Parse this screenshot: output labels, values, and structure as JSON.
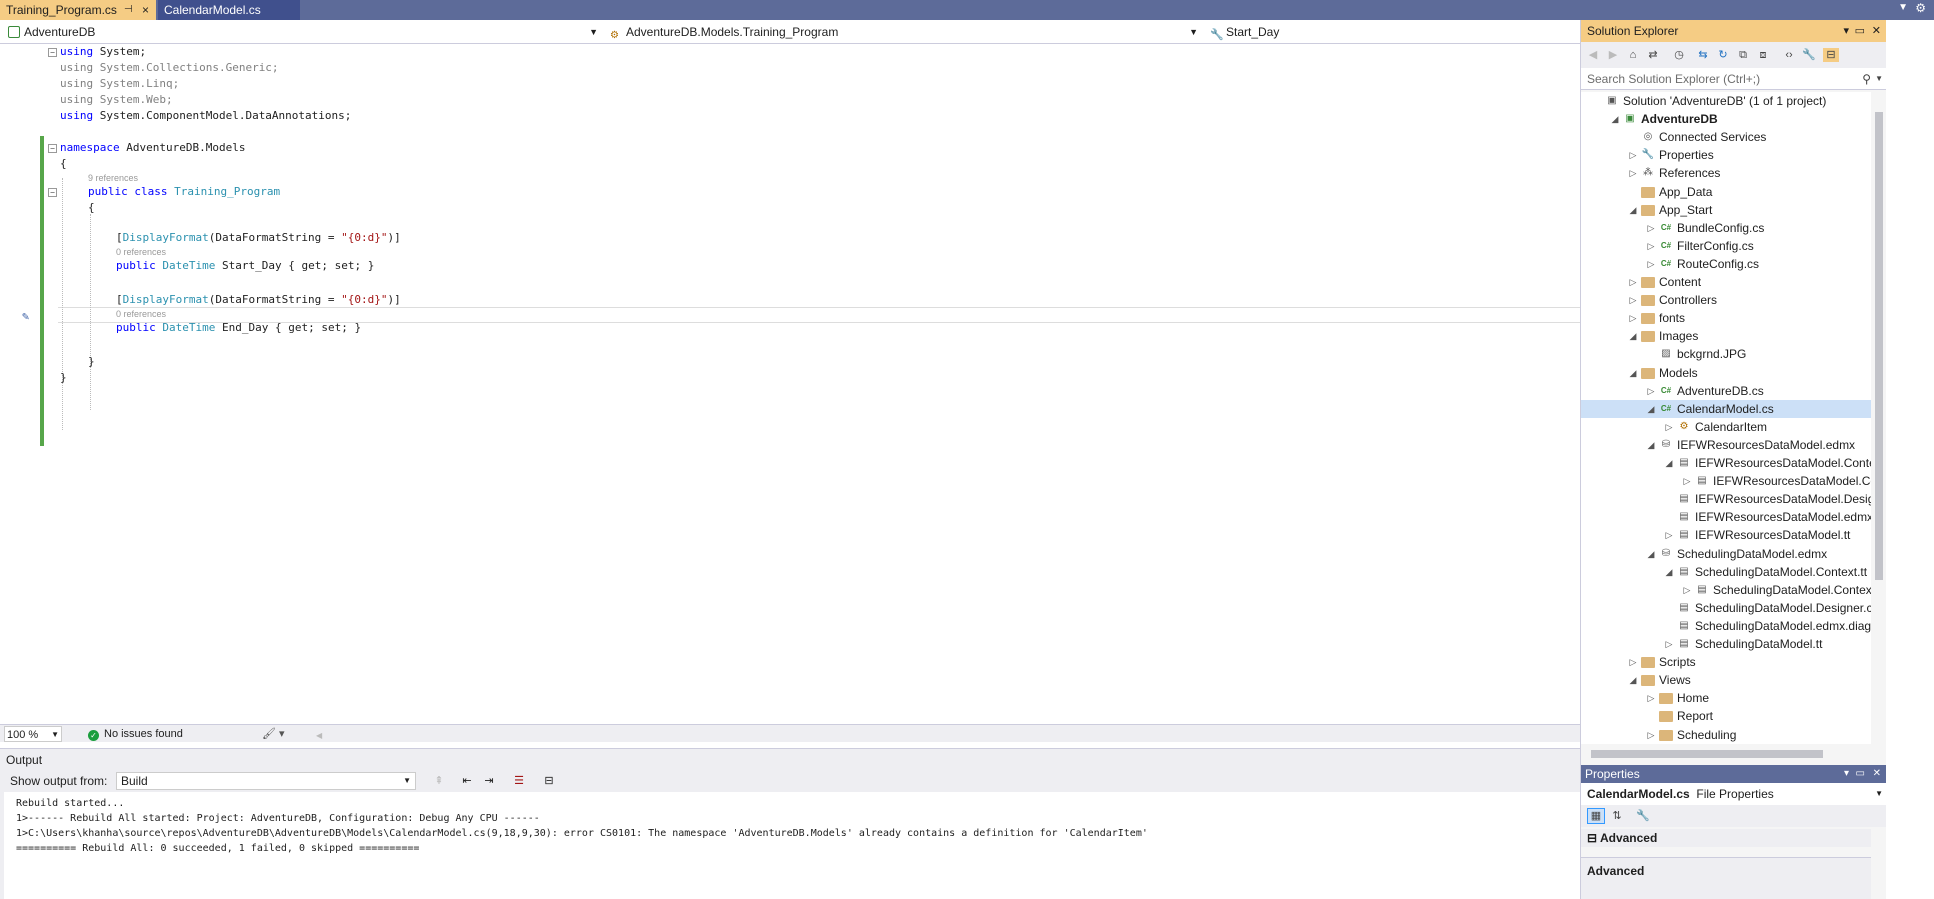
{
  "tabs": [
    {
      "label": "Training_Program.cs",
      "active": true,
      "pin": "⊣",
      "close": "×"
    },
    {
      "label": "CalendarModel.cs",
      "active": false
    }
  ],
  "nav": {
    "project": "AdventureDB",
    "type": "AdventureDB.Models.Training_Program",
    "member": "Start_Day"
  },
  "code": {
    "l1_kw": "using",
    "l1_rest": " System;",
    "l2_kw": "using",
    "l2_rest": " System.Collections.Generic;",
    "l3_kw": "using",
    "l3_rest": " System.Linq;",
    "l4_kw": "using",
    "l4_rest": " System.Web;",
    "l5_kw": "using",
    "l5_rest": " System.ComponentModel.DataAnnotations;",
    "ns_kw": "namespace",
    "ns_name": " AdventureDB.Models",
    "brace_open": "{",
    "ref9": "9 references",
    "class_kw": "public class",
    "class_name": " Training_Program",
    "brace_open2": "{",
    "attr1_pre": "[",
    "attr1_ty": "DisplayFormat",
    "attr1_mid": "(DataFormatString = ",
    "attr1_str": "\"{0:d}\"",
    "attr1_end": ")]",
    "ref0a": "0 references",
    "prop1_kw": "public",
    "prop1_ty": " DateTime",
    "prop1_name": " Start_Day ",
    "prop1_acc": "{ get; set; }",
    "attr2_pre": "[",
    "attr2_ty": "DisplayFormat",
    "attr2_mid": "(DataFormatString = ",
    "attr2_str": "\"{0:d}\"",
    "attr2_end": ")]",
    "ref0b": "0 references",
    "prop2_kw": "public",
    "prop2_ty": " DateTime",
    "prop2_name": " End_Day ",
    "prop2_acc": "{ get; set; }",
    "brace_close2": "}",
    "brace_close": "}"
  },
  "status": {
    "zoom": "100 %",
    "issues": "No issues found"
  },
  "output": {
    "title": "Output",
    "show_label": "Show output from:",
    "source": "Build",
    "lines": [
      "Rebuild started...",
      "1>------ Rebuild All started: Project: AdventureDB, Configuration: Debug Any CPU ------",
      "1>C:\\Users\\khanha\\source\\repos\\AdventureDB\\AdventureDB\\Models\\CalendarModel.cs(9,18,9,30): error CS0101: The namespace 'AdventureDB.Models' already contains a definition for 'CalendarItem'",
      "========== Rebuild All: 0 succeeded, 1 failed, 0 skipped =========="
    ]
  },
  "solution_explorer": {
    "title": "Solution Explorer",
    "search_placeholder": "Search Solution Explorer (Ctrl+;)",
    "items": [
      {
        "label": "Solution 'AdventureDB' (1 of 1 project)",
        "depth": 0,
        "exp": "",
        "icon": "solution-icon"
      },
      {
        "label": "AdventureDB",
        "depth": 1,
        "exp": "◢",
        "icon": "project-icon",
        "bold": true
      },
      {
        "label": "Connected Services",
        "depth": 2,
        "exp": "",
        "icon": "connected-services-icon"
      },
      {
        "label": "Properties",
        "depth": 2,
        "exp": "▷",
        "icon": "wrench-icon"
      },
      {
        "label": "References",
        "depth": 2,
        "exp": "▷",
        "icon": "references-icon"
      },
      {
        "label": "App_Data",
        "depth": 2,
        "exp": "",
        "icon": "folder-icon"
      },
      {
        "label": "App_Start",
        "depth": 2,
        "exp": "◢",
        "icon": "folder-icon"
      },
      {
        "label": "BundleConfig.cs",
        "depth": 3,
        "exp": "▷",
        "icon": "csharp-file-icon"
      },
      {
        "label": "FilterConfig.cs",
        "depth": 3,
        "exp": "▷",
        "icon": "csharp-file-icon"
      },
      {
        "label": "RouteConfig.cs",
        "depth": 3,
        "exp": "▷",
        "icon": "csharp-file-icon"
      },
      {
        "label": "Content",
        "depth": 2,
        "exp": "▷",
        "icon": "folder-icon"
      },
      {
        "label": "Controllers",
        "depth": 2,
        "exp": "▷",
        "icon": "folder-icon"
      },
      {
        "label": "fonts",
        "depth": 2,
        "exp": "▷",
        "icon": "folder-icon"
      },
      {
        "label": "Images",
        "depth": 2,
        "exp": "◢",
        "icon": "folder-icon"
      },
      {
        "label": "bckgrnd.JPG",
        "depth": 3,
        "exp": "",
        "icon": "image-file-icon"
      },
      {
        "label": "Models",
        "depth": 2,
        "exp": "◢",
        "icon": "folder-icon"
      },
      {
        "label": "AdventureDB.cs",
        "depth": 3,
        "exp": "▷",
        "icon": "csharp-file-icon"
      },
      {
        "label": "CalendarModel.cs",
        "depth": 3,
        "exp": "◢",
        "icon": "csharp-file-icon",
        "selected": true
      },
      {
        "label": "CalendarItem",
        "depth": 4,
        "exp": "▷",
        "icon": "class-icon"
      },
      {
        "label": "IEFWResourcesDataModel.edmx",
        "depth": 3,
        "exp": "◢",
        "icon": "edmx-icon"
      },
      {
        "label": "IEFWResourcesDataModel.Contex",
        "depth": 4,
        "exp": "◢",
        "icon": "file-icon"
      },
      {
        "label": "IEFWResourcesDataModel.Cor",
        "depth": 5,
        "exp": "▷",
        "icon": "file-icon"
      },
      {
        "label": "IEFWResourcesDataModel.Designe",
        "depth": 4,
        "exp": "",
        "icon": "file-icon"
      },
      {
        "label": "IEFWResourcesDataModel.edmx.c",
        "depth": 4,
        "exp": "",
        "icon": "file-icon"
      },
      {
        "label": "IEFWResourcesDataModel.tt",
        "depth": 4,
        "exp": "▷",
        "icon": "file-icon"
      },
      {
        "label": "SchedulingDataModel.edmx",
        "depth": 3,
        "exp": "◢",
        "icon": "edmx-icon"
      },
      {
        "label": "SchedulingDataModel.Context.tt",
        "depth": 4,
        "exp": "◢",
        "icon": "file-icon"
      },
      {
        "label": "SchedulingDataModel.Context",
        "depth": 5,
        "exp": "▷",
        "icon": "file-icon"
      },
      {
        "label": "SchedulingDataModel.Designer.cs",
        "depth": 4,
        "exp": "",
        "icon": "file-icon"
      },
      {
        "label": "SchedulingDataModel.edmx.diag",
        "depth": 4,
        "exp": "",
        "icon": "file-icon"
      },
      {
        "label": "SchedulingDataModel.tt",
        "depth": 4,
        "exp": "▷",
        "icon": "file-icon"
      },
      {
        "label": "Scripts",
        "depth": 2,
        "exp": "▷",
        "icon": "folder-icon"
      },
      {
        "label": "Views",
        "depth": 2,
        "exp": "◢",
        "icon": "folder-icon"
      },
      {
        "label": "Home",
        "depth": 3,
        "exp": "▷",
        "icon": "folder-icon"
      },
      {
        "label": "Report",
        "depth": 3,
        "exp": "",
        "icon": "folder-icon"
      },
      {
        "label": "Scheduling",
        "depth": 3,
        "exp": "▷",
        "icon": "folder-icon"
      }
    ]
  },
  "properties": {
    "title": "Properties",
    "object": "CalendarModel.cs",
    "object_type": "File Properties",
    "category": "Advanced",
    "description": "Advanced"
  },
  "colors": {
    "accent_tab": "#f5cc84",
    "tab_strip": "#5d6b99",
    "keyword": "#0000ff",
    "type": "#2b91af",
    "string": "#a31515",
    "change_bar": "#57a64a",
    "selection": "#cce0f7"
  }
}
